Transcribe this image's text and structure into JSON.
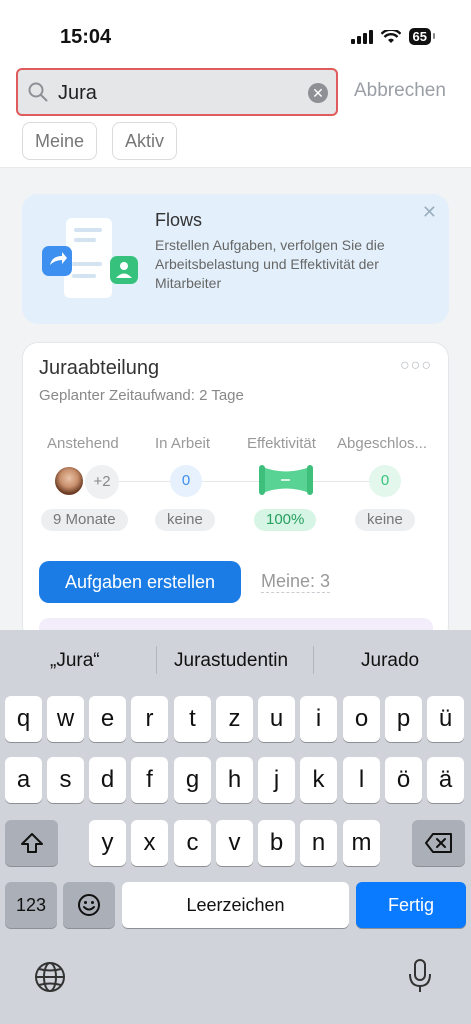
{
  "status_bar": {
    "time": "15:04",
    "battery": "65"
  },
  "search": {
    "value": "Jura",
    "cancel_label": "Abbrechen"
  },
  "filters": [
    "Meine",
    "Aktiv"
  ],
  "banner": {
    "title": "Flows",
    "text": "Erstellen Aufgaben, verfolgen Sie die Arbeitsbelastung und Effektivität der Mitarbeiter"
  },
  "flow_card": {
    "title": "Juraabteilung",
    "subtitle": "Geplanter Zeitaufwand: 2 Tage",
    "columns": [
      {
        "label": "Anstehend",
        "extra": "+2",
        "pill": "9 Monate"
      },
      {
        "label": "In Arbeit",
        "count": "0",
        "pill": "keine"
      },
      {
        "label": "Effektivität",
        "pill": "100%"
      },
      {
        "label": "Abgeschlos...",
        "count": "0",
        "pill": "keine"
      }
    ],
    "create_button": "Aufgaben erstellen",
    "mine_link": "Meine: 3"
  },
  "keyboard": {
    "suggestions": [
      "„Jura“",
      "Jurastudentin",
      "Jurado"
    ],
    "row1": [
      "q",
      "w",
      "e",
      "r",
      "t",
      "z",
      "u",
      "i",
      "o",
      "p",
      "ü"
    ],
    "row2": [
      "a",
      "s",
      "d",
      "f",
      "g",
      "h",
      "j",
      "k",
      "l",
      "ö",
      "ä"
    ],
    "row3": [
      "y",
      "x",
      "c",
      "v",
      "b",
      "n",
      "m"
    ],
    "numbers_key": "123",
    "space_key": "Leerzeichen",
    "done_key": "Fertig"
  },
  "colors": {
    "accent": "#1b7ce6",
    "search_outline": "#e05b5b",
    "effectivity_green": "#28a060"
  }
}
